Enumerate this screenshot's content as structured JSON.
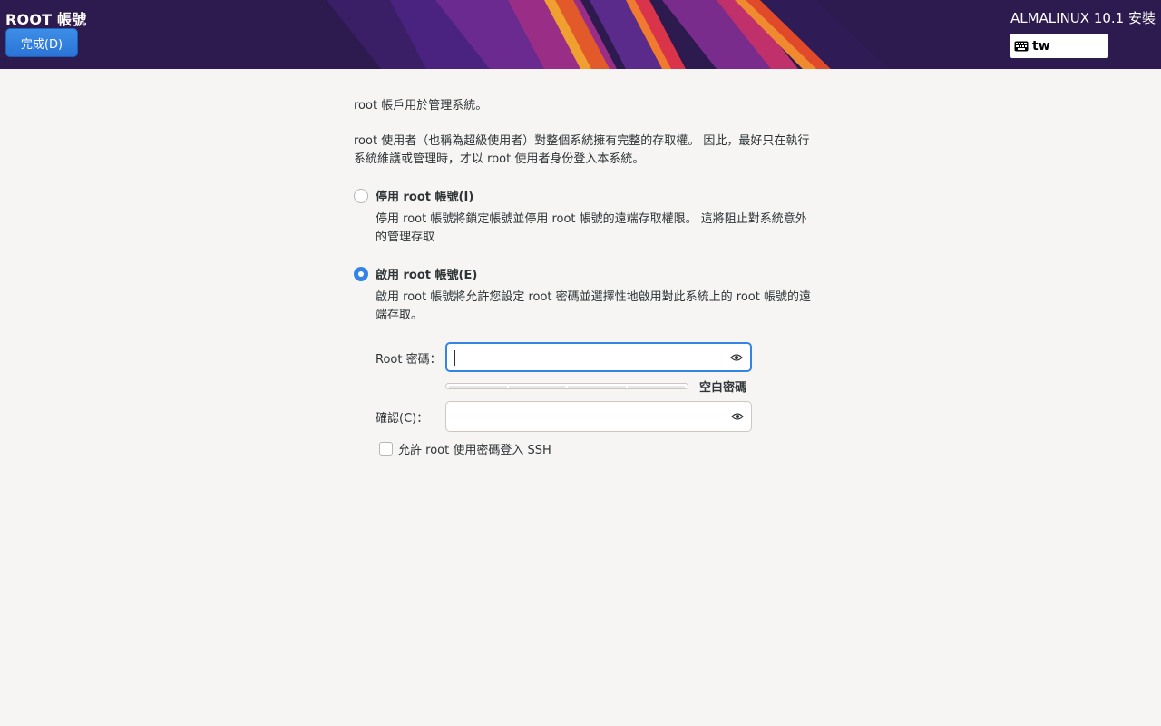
{
  "header": {
    "page_title": "ROOT 帳號",
    "done_label": "完成(D)",
    "product_title": "ALMALINUX 10.1 安裝",
    "keyboard_layout": "tw",
    "colors": {
      "background": "#2d1a4f",
      "accent_orange": "#f06a2a",
      "accent_red": "#d9344a"
    }
  },
  "intro": {
    "line1": "root 帳戶用於管理系統。",
    "line2": "root 使用者（也稱為超級使用者）對整個系統擁有完整的存取權。 因此，最好只在執行系統維護或管理時，才以 root 使用者身份登入本系統。"
  },
  "options": {
    "disable": {
      "label": "停用 root 帳號(I)",
      "description": "停用 root 帳號將鎖定帳號並停用 root 帳號的遠端存取權限。 這將阻止對系統意外的管理存取",
      "selected": false
    },
    "enable": {
      "label": "啟用 root 帳號(E)",
      "description": "啟用 root 帳號將允許您設定 root 密碼並選擇性地啟用對此系統上的 root 帳號的遠端存取。",
      "selected": true
    }
  },
  "password": {
    "root_label": "Root 密碼：",
    "root_value": "",
    "strength_text": "空白密碼",
    "strength_level": 0,
    "confirm_label": "確認(C)：",
    "confirm_value": ""
  },
  "ssh": {
    "label": "允許 root 使用密碼登入 SSH",
    "checked": false
  },
  "icons": {
    "keyboard": "keyboard-icon",
    "reveal": "eye-icon"
  },
  "colors": {
    "accent": "#3584e4",
    "page_bg": "#f6f5f4",
    "text": "#2e3436"
  }
}
